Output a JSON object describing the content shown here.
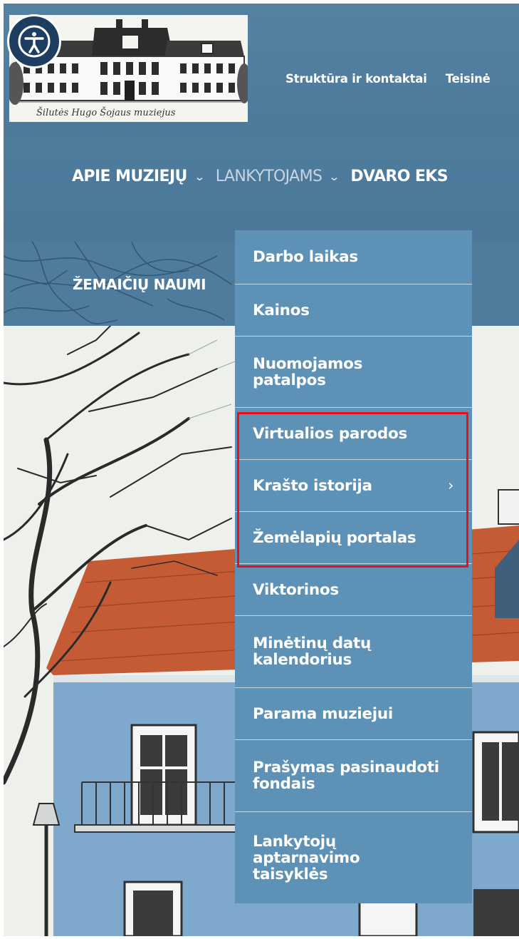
{
  "site": {
    "logo_alt": "Šilutės Hugo Šojaus muziejus",
    "logo_caption": "Šilutės Hugo Šojaus muziejus"
  },
  "accessibility": {
    "icon": "accessibility-person-icon"
  },
  "top_links": [
    "Struktūra ir kontaktai",
    "Teisinė"
  ],
  "main_nav": [
    {
      "label": "APIE MUZIEJŲ",
      "has_dropdown": true,
      "active": false
    },
    {
      "label": "LANKYTOJAMS",
      "has_dropdown": true,
      "active": true
    },
    {
      "label": "DVARO EKS",
      "has_dropdown": false,
      "active": false
    }
  ],
  "second_nav": {
    "label": "ŽEMAIČIŲ NAUMI"
  },
  "dropdown": {
    "items": [
      {
        "label": "Darbo laikas",
        "submenu": false
      },
      {
        "label": "Kainos",
        "submenu": false
      },
      {
        "label": "Nuomojamos patalpos",
        "submenu": false
      },
      {
        "label": "Virtualios parodos",
        "submenu": false
      },
      {
        "label": "Krašto istorija",
        "submenu": true
      },
      {
        "label": "Žemėlapių portalas",
        "submenu": false
      },
      {
        "label": "Viktorinos",
        "submenu": false
      },
      {
        "label": "Minėtinų datų kalendorius",
        "submenu": false
      },
      {
        "label": "Parama muziejui",
        "submenu": false
      },
      {
        "label": "Prašymas pasinaudoti fondais",
        "submenu": false
      },
      {
        "label": "Lankytojų aptarnavimo taisyklės",
        "submenu": false
      }
    ],
    "submenu_arrow": "›"
  },
  "colors": {
    "header_blue": "#4e7c9d",
    "dropdown_blue": "#5d91b5",
    "accessibility_navy": "#1d3d61",
    "highlight_red": "#e8101a"
  }
}
